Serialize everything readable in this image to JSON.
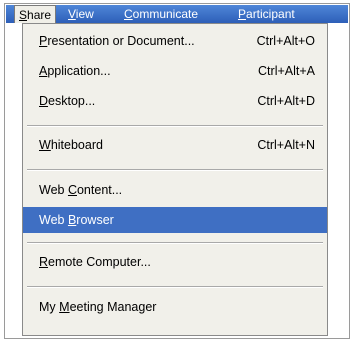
{
  "menubar": {
    "items": [
      {
        "label": "Share",
        "accel": "S",
        "rest": "hare"
      },
      {
        "label": "View",
        "accel": "V",
        "rest": "iew"
      },
      {
        "label": "Communicate",
        "accel": "C",
        "rest": "ommunicate"
      },
      {
        "label": "Participant",
        "accel": "P",
        "rest": "articipant"
      }
    ]
  },
  "share_menu": {
    "items": [
      {
        "accel": "P",
        "rest": "resentation or Document...",
        "label": "Presentation or Document...",
        "shortcut": "Ctrl+Alt+O"
      },
      {
        "accel": "A",
        "rest": "pplication...",
        "label": "Application...",
        "shortcut": "Ctrl+Alt+A"
      },
      {
        "accel": "D",
        "rest": "esktop...",
        "label": "Desktop...",
        "shortcut": "Ctrl+Alt+D"
      },
      {
        "accel": "W",
        "rest": "hiteboard",
        "label": "Whiteboard",
        "shortcut": "Ctrl+Alt+N"
      },
      {
        "before": "Web ",
        "accel": "C",
        "rest": "ontent...",
        "label": "Web Content...",
        "shortcut": ""
      },
      {
        "before": "Web ",
        "accel": "B",
        "rest": "rowser",
        "label": "Web Browser",
        "shortcut": "",
        "highlighted": true
      },
      {
        "accel": "R",
        "rest": "emote Computer...",
        "label": "Remote Computer...",
        "shortcut": ""
      },
      {
        "before": "My ",
        "accel": "M",
        "rest": "eeting Manager",
        "label": "My Meeting Manager",
        "shortcut": ""
      }
    ]
  }
}
